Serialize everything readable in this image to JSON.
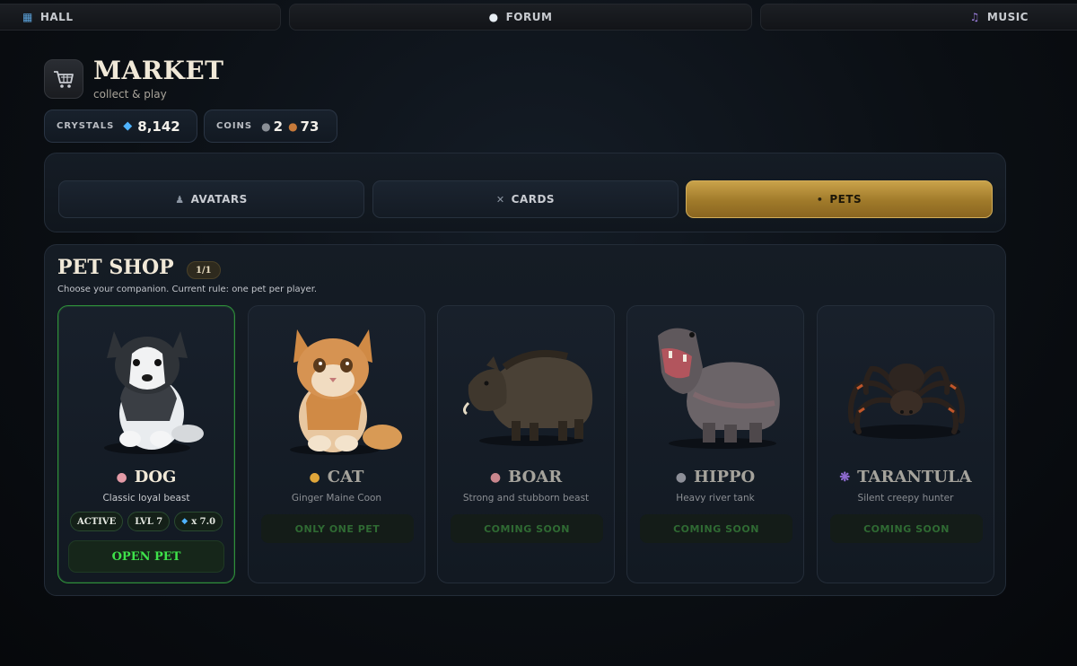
{
  "nav": {
    "hall": {
      "label": "HALL",
      "icon": "map-icon"
    },
    "forum": {
      "label": "FORUM",
      "icon": "speech-bubble-icon"
    },
    "music": {
      "label": "MUSIC",
      "icon": "music-note-icon"
    }
  },
  "header": {
    "title": "MARKET",
    "subtitle": "collect & play",
    "logo_icon": "shopping-cart-icon"
  },
  "wallet": {
    "crystals_label": "CRYSTALS",
    "crystals_value": "8,142",
    "coins_label": "COINS",
    "coins_silver": "2",
    "coins_bronze": "73"
  },
  "tabs": [
    {
      "label": "AVATARS",
      "icon": "avatar-icon",
      "active": false
    },
    {
      "label": "CARDS",
      "icon": "crossed-swords-icon",
      "active": false
    },
    {
      "label": "PETS",
      "icon": "paw-icon",
      "active": true
    }
  ],
  "shop": {
    "title": "PET SHOP",
    "page": "1/1",
    "description": "Choose your companion. Current rule: one pet per player."
  },
  "pets": [
    {
      "name": "DOG",
      "icon": "dog-face-icon",
      "subtitle": "Classic loyal beast",
      "chips": [
        "ACTIVE",
        "LVL 7",
        "x 7.0"
      ],
      "action": "OPEN PET"
    },
    {
      "name": "CAT",
      "icon": "cat-face-icon",
      "subtitle": "Ginger Maine Coon",
      "action": "ONLY ONE PET"
    },
    {
      "name": "BOAR",
      "icon": "boar-icon",
      "subtitle": "Strong and stubborn beast",
      "action": "COMING SOON"
    },
    {
      "name": "HIPPO",
      "icon": "hippo-icon",
      "subtitle": "Heavy river tank",
      "action": "COMING SOON"
    },
    {
      "name": "TARANTULA",
      "icon": "spider-icon",
      "subtitle": "Silent creepy hunter",
      "action": "COMING SOON"
    }
  ],
  "colors": {
    "accent_gold": "#b8902f",
    "active_green": "#3ee24a",
    "selected_border": "#2f8f3a",
    "crystal_blue": "#4fb3ff"
  }
}
